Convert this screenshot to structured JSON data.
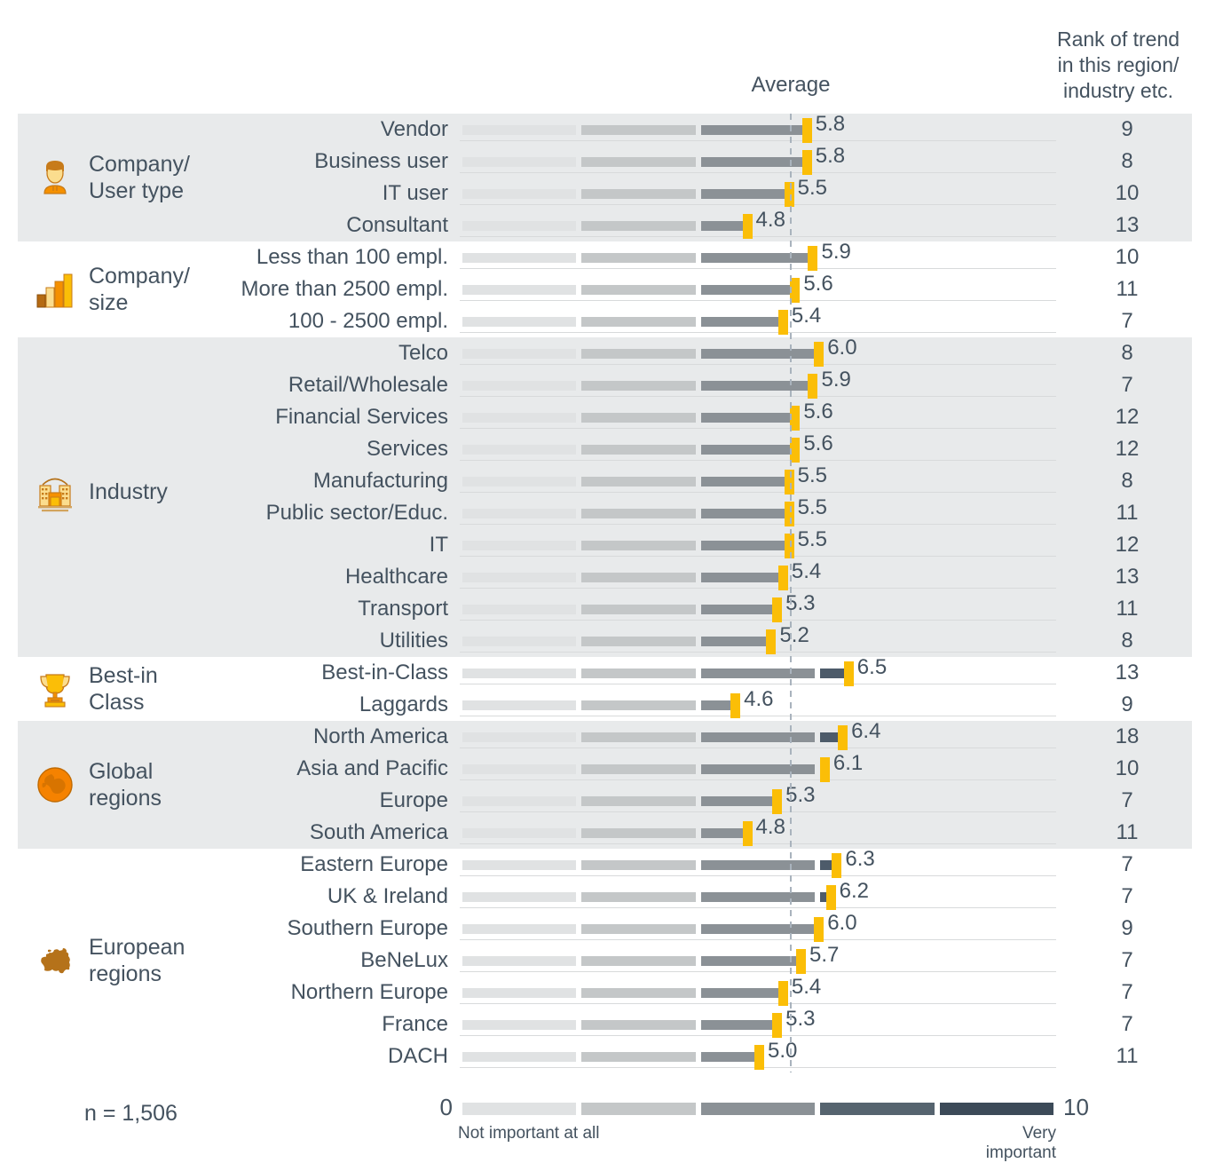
{
  "header": {
    "average_label": "Average",
    "rank_header": "Rank of trend\nin this region/\nindustry etc."
  },
  "footer": {
    "n_label": "n = 1,506",
    "scale_min": "0",
    "scale_max": "10",
    "legend_left": "Not important at all",
    "legend_right": "Very important"
  },
  "colors": {
    "marker": "#fbbe07",
    "text": "#44525f",
    "band_shaded": "#e8eaeb",
    "seg1": "#e0e2e3",
    "seg2": "#c4c7c8",
    "seg3": "#8b9196",
    "seg4": "#4d5b6a",
    "avg_line": "#a9b3bd"
  },
  "chart_data": {
    "type": "bar",
    "title": "",
    "xlabel": "",
    "ylabel": "",
    "xlim": [
      0,
      10
    ],
    "average_line": 5.55,
    "scale_labels": {
      "min": "Not important at all",
      "max": "Very important"
    },
    "sample_size": "n = 1,506",
    "value_column": "Average",
    "rank_column": "Rank of trend in this region/ industry etc.",
    "groups": [
      {
        "name": "Company/\nUser type",
        "icon": "person-icon",
        "shaded": true,
        "rows": [
          {
            "label": "Vendor",
            "value": 5.8,
            "rank": 9
          },
          {
            "label": "Business user",
            "value": 5.8,
            "rank": 8
          },
          {
            "label": "IT user",
            "value": 5.5,
            "rank": 10
          },
          {
            "label": "Consultant",
            "value": 4.8,
            "rank": 13
          }
        ]
      },
      {
        "name": "Company/\nsize",
        "icon": "bar-chart-icon",
        "shaded": false,
        "rows": [
          {
            "label": "Less than 100 empl.",
            "value": 5.9,
            "rank": 10
          },
          {
            "label": "More than 2500 empl.",
            "value": 5.6,
            "rank": 11
          },
          {
            "label": "100 - 2500 empl.",
            "value": 5.4,
            "rank": 7
          }
        ]
      },
      {
        "name": "Industry",
        "icon": "factory-icon",
        "shaded": true,
        "rows": [
          {
            "label": "Telco",
            "value": 6.0,
            "rank": 8
          },
          {
            "label": "Retail/Wholesale",
            "value": 5.9,
            "rank": 7
          },
          {
            "label": "Financial Services",
            "value": 5.6,
            "rank": 12
          },
          {
            "label": "Services",
            "value": 5.6,
            "rank": 12
          },
          {
            "label": "Manufacturing",
            "value": 5.5,
            "rank": 8
          },
          {
            "label": "Public sector/Educ.",
            "value": 5.5,
            "rank": 11
          },
          {
            "label": "IT",
            "value": 5.5,
            "rank": 12
          },
          {
            "label": "Healthcare",
            "value": 5.4,
            "rank": 13
          },
          {
            "label": "Transport",
            "value": 5.3,
            "rank": 11
          },
          {
            "label": "Utilities",
            "value": 5.2,
            "rank": 8
          }
        ]
      },
      {
        "name": "Best-in\nClass",
        "icon": "trophy-icon",
        "shaded": false,
        "rows": [
          {
            "label": "Best-in-Class",
            "value": 6.5,
            "rank": 13
          },
          {
            "label": "Laggards",
            "value": 4.6,
            "rank": 9
          }
        ]
      },
      {
        "name": "Global\nregions",
        "icon": "globe-icon",
        "shaded": true,
        "rows": [
          {
            "label": "North America",
            "value": 6.4,
            "rank": 18
          },
          {
            "label": "Asia and Pacific",
            "value": 6.1,
            "rank": 10
          },
          {
            "label": "Europe",
            "value": 5.3,
            "rank": 7
          },
          {
            "label": "South America",
            "value": 4.8,
            "rank": 11
          }
        ]
      },
      {
        "name": "European\nregions",
        "icon": "europe-map-icon",
        "shaded": false,
        "rows": [
          {
            "label": "Eastern Europe",
            "value": 6.3,
            "rank": 7
          },
          {
            "label": "UK & Ireland",
            "value": 6.2,
            "rank": 7
          },
          {
            "label": "Southern Europe",
            "value": 6.0,
            "rank": 9
          },
          {
            "label": "BeNeLux",
            "value": 5.7,
            "rank": 7
          },
          {
            "label": "Northern Europe",
            "value": 5.4,
            "rank": 7
          },
          {
            "label": "France",
            "value": 5.3,
            "rank": 7
          },
          {
            "label": "DACH",
            "value": 5.0,
            "rank": 11
          }
        ]
      }
    ],
    "scale_segments": [
      "#e0e2e3",
      "#c4c7c8",
      "#8b9196",
      "#56646f",
      "#3c4a58"
    ]
  }
}
